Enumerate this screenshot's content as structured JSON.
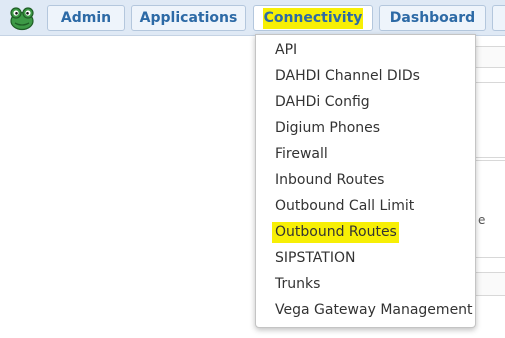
{
  "nav": {
    "admin_label": "Admin",
    "applications_label": "Applications",
    "connectivity_label": "Connectivity",
    "dashboard_label": "Dashboard"
  },
  "connectivity_menu": {
    "items": [
      "API",
      "DAHDI Channel DIDs",
      "DAHDi Config",
      "Digium Phones",
      "Firewall",
      "Inbound Routes",
      "Outbound Call Limit",
      "Outbound Routes",
      "SIPSTATION",
      "Trunks",
      "Vega Gateway Management"
    ],
    "highlighted_item": "Outbound Routes"
  },
  "background": {
    "peek_text": "e"
  },
  "colors": {
    "nav_bg": "#dfe9f5",
    "nav_text": "#2d6aa6",
    "highlight": "#f7ef05"
  },
  "icons": {
    "logo": "frog-logo-icon"
  }
}
